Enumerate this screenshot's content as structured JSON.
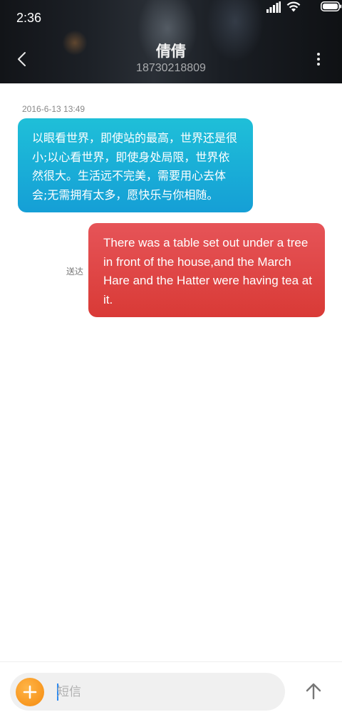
{
  "status_bar": {
    "time": "2:36"
  },
  "header": {
    "contact_name": "倩倩",
    "contact_number": "18730218809"
  },
  "conversation": {
    "timestamp": "2016-6-13 13:49",
    "messages": [
      {
        "direction": "incoming",
        "text": "以眼看世界，即使站的最高，世界还是很小;以心看世界，即使身处局限，世界依然很大。生活远不完美，需要用心去体会;无需拥有太多，愿快乐与你相随。"
      },
      {
        "direction": "outgoing",
        "text": "There was a table set out under a tree in front of the house,and the March Hare and the Hatter were having tea at it.",
        "status": "送达"
      }
    ]
  },
  "composer": {
    "placeholder": "短信",
    "value": ""
  },
  "colors": {
    "incoming_bubble": "#1aaed7",
    "outgoing_bubble": "#de4643",
    "add_button": "#f7951c",
    "cursor": "#2f8bf0"
  },
  "icons": {
    "back": "chevron-left-icon",
    "more": "more-vertical-icon",
    "add": "plus-icon",
    "send": "arrow-up-icon",
    "signal": "signal-icon",
    "wifi": "wifi-icon",
    "battery": "battery-icon"
  }
}
